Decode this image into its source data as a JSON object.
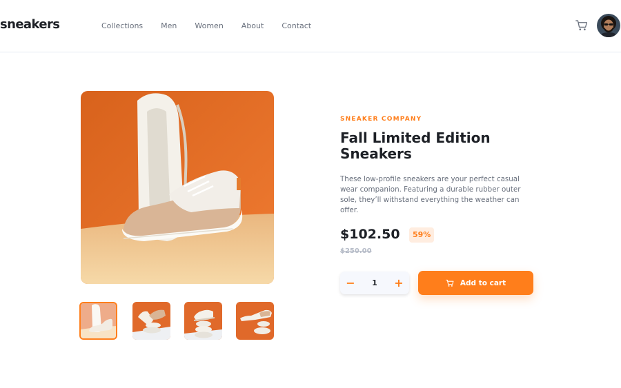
{
  "header": {
    "logo": "sneakers",
    "nav": [
      "Collections",
      "Men",
      "Women",
      "About",
      "Contact"
    ],
    "cart_icon": "cart-icon",
    "avatar_icon": "user-avatar"
  },
  "product": {
    "company": "SNEAKER COMPANY",
    "title": "Fall Limited Edition Sneakers",
    "description": "These low-profile sneakers are your perfect casual wear companion. Featuring a durable rubber outer sole, they’ll withstand everything the weather can offer.",
    "price": "$102.50",
    "discount": "59%",
    "old_price": "$250.00",
    "quantity": "1",
    "minus_label": "−",
    "plus_label": "+",
    "add_to_cart": "Add to cart",
    "selected_thumbnail": 1
  },
  "colors": {
    "accent": "#ff7e1b",
    "accent_pale": "#ffede0",
    "text_dark": "#1d2026",
    "text_gray": "#69707d"
  }
}
